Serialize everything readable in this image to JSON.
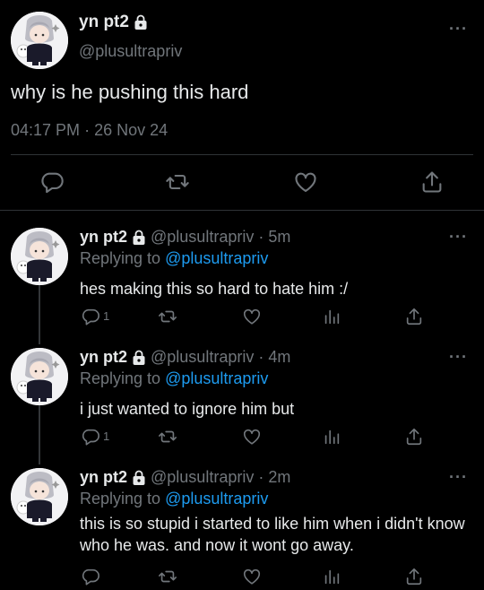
{
  "main_tweet": {
    "name": "yn pt2",
    "handle": "@plusultrapriv",
    "text": "why is he pushing this hard",
    "time": "04:17 PM",
    "dot": "·",
    "date": "26 Nov 24"
  },
  "replies": [
    {
      "name": "yn pt2",
      "handle": "@plusultrapriv",
      "age": "· 5m",
      "replying_prefix": "Replying to",
      "replying_to": "@plusultrapriv",
      "text": "hes making this so hard to hate him :/",
      "reply_count": "1"
    },
    {
      "name": "yn pt2",
      "handle": "@plusultrapriv",
      "age": "· 4m",
      "replying_prefix": "Replying to",
      "replying_to": "@plusultrapriv",
      "text": "i just wanted to ignore him but",
      "reply_count": "1"
    },
    {
      "name": "yn pt2",
      "handle": "@plusultrapriv",
      "age": "· 2m",
      "replying_prefix": "Replying to",
      "replying_to": "@plusultrapriv",
      "text": "this is so stupid i started to like him when i didn't know who he was. and now it wont go away.",
      "reply_count": ""
    }
  ],
  "colors": {
    "background": "#000000",
    "text": "#e7e9ea",
    "muted": "#71767b",
    "link": "#1d9bf0",
    "divider": "#2f3336"
  },
  "icons": [
    "lock-icon",
    "more-icon",
    "reply-icon",
    "retweet-icon",
    "like-icon",
    "views-icon",
    "share-icon",
    "avatar"
  ]
}
